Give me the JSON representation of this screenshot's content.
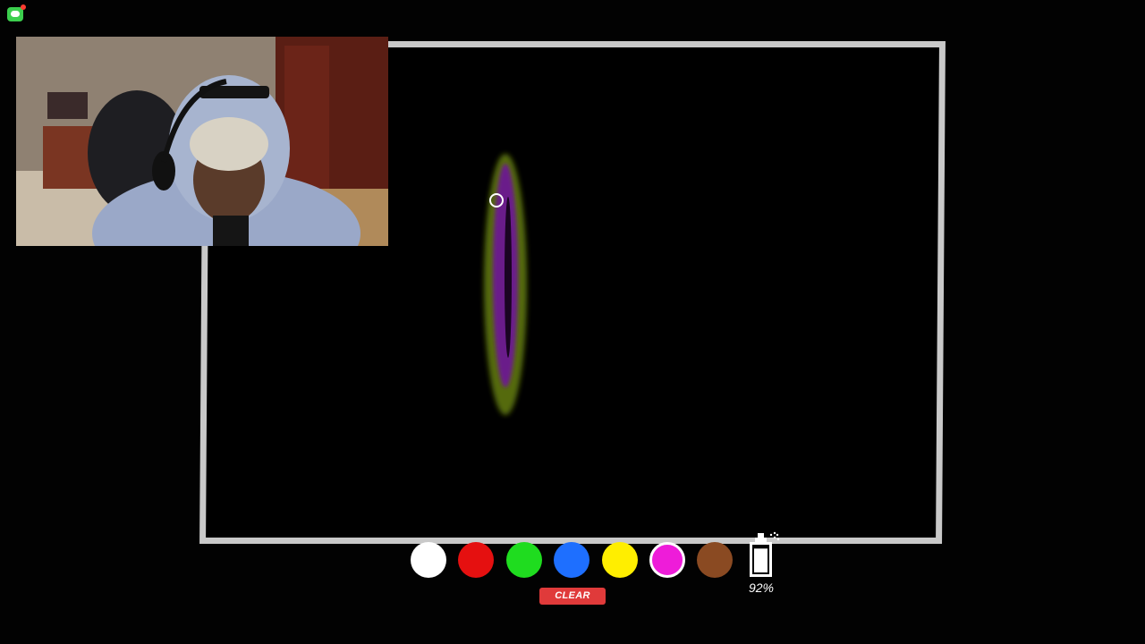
{
  "palette": {
    "colors": [
      {
        "name": "white",
        "hex": "#ffffff",
        "selected": false
      },
      {
        "name": "red",
        "hex": "#e51010",
        "selected": false
      },
      {
        "name": "green",
        "hex": "#1fdc1f",
        "selected": false
      },
      {
        "name": "blue",
        "hex": "#1e6fff",
        "selected": false
      },
      {
        "name": "yellow",
        "hex": "#ffee00",
        "selected": false
      },
      {
        "name": "magenta",
        "hex": "#ee1cd9",
        "selected": true
      },
      {
        "name": "brown",
        "hex": "#8a4a22",
        "selected": false
      }
    ]
  },
  "clear_label": "CLEAR",
  "paint_level": {
    "percent": 92,
    "label": "92%"
  },
  "colors": {
    "background": "#000000",
    "board_border": "#c9c9c9",
    "clear_button": "#e03a3a",
    "stroke_outer": "#556b10",
    "stroke_inner": "#6a1a8a"
  },
  "icons": {
    "app": "chat-bubble-icon",
    "paint_can": "spray-can-icon",
    "cursor": "brush-cursor-icon"
  }
}
